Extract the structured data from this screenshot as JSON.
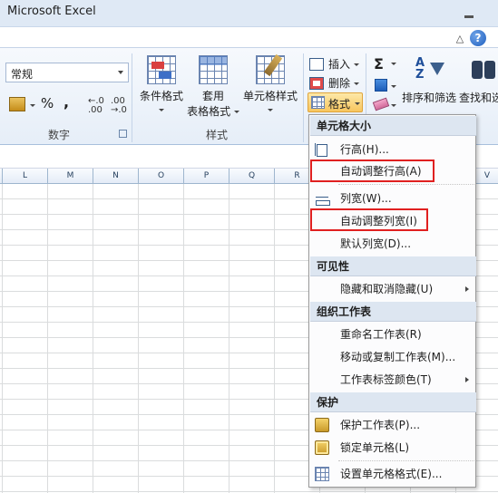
{
  "window": {
    "title": "Microsoft Excel"
  },
  "ribbon": {
    "number_group": {
      "format_select_value": "常规",
      "percent_label": "%",
      "comma_label": ",",
      "increase_decimal": "←.0\n.00",
      "decrease_decimal": ".00\n→.0",
      "label": "数字"
    },
    "styles_group": {
      "conditional_format_label": "条件格式",
      "table_format_label_1": "套用",
      "table_format_label_2": "表格格式",
      "cell_styles_label": "单元格样式",
      "label": "样式"
    },
    "cells_group": {
      "insert_label": "插入",
      "delete_label": "删除",
      "format_label": "格式"
    },
    "editing_group": {
      "sum_label": "Σ",
      "sort_filter_label": "排序和筛选",
      "find_select_label": "查找和选"
    }
  },
  "sheet": {
    "columns": [
      "L",
      "M",
      "N",
      "O",
      "P",
      "Q",
      "R",
      "V"
    ]
  },
  "format_menu": {
    "sections": [
      {
        "header": "单元格大小"
      },
      {
        "header": "可见性"
      },
      {
        "header": "组织工作表"
      },
      {
        "header": "保护"
      }
    ],
    "items": {
      "row_height": "行高(H)...",
      "autofit_row_height": "自动调整行高(A)",
      "column_width": "列宽(W)...",
      "autofit_column_width": "自动调整列宽(I)",
      "default_width": "默认列宽(D)...",
      "hide_unhide": "隐藏和取消隐藏(U)",
      "rename_sheet": "重命名工作表(R)",
      "move_copy_sheet": "移动或复制工作表(M)...",
      "tab_color": "工作表标签颜色(T)",
      "protect_sheet": "保护工作表(P)...",
      "lock_cell": "锁定单元格(L)",
      "format_cells": "设置单元格格式(E)..."
    }
  },
  "colors": {
    "highlight_border": "#e02020",
    "format_button_bg": "#f7c55e",
    "ribbon_bg": "#e6eef8"
  }
}
